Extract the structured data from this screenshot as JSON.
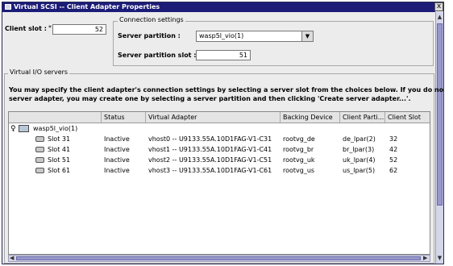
{
  "window": {
    "title": "Virtual SCSI -- Client Adapter Properties",
    "close_label": "x"
  },
  "client_slot": {
    "label": "Client slot :",
    "required_mark": "*",
    "value": "52"
  },
  "connection": {
    "legend": "Connection settings",
    "partition_label": "Server partition :",
    "partition_value": "wasp5l_vio(1)",
    "slot_label": "Server partition slot :",
    "slot_value": "51"
  },
  "vio": {
    "legend": "Virtual I/O servers",
    "instructions": [
      "You may specify the client adapter's connection settings by selecting a server slot from the choices below. If you do not see a",
      "server adapter, you may create one by selecting a server partition and then clicking 'Create server adapter...'."
    ]
  },
  "table": {
    "headers": [
      "Status",
      "Virtual Adapter",
      "Backing Device",
      "Client Parti...",
      "Client Slot",
      "C"
    ],
    "root": "wasp5l_vio(1)",
    "rows": [
      {
        "slot": "Slot 31",
        "status": "Inactive",
        "adapter": "vhost0 -- U9133.55A.10D1FAG-V1-C31",
        "backing": "rootvg_de",
        "client": "de_lpar(2)",
        "client_slot": "32"
      },
      {
        "slot": "Slot 41",
        "status": "Inactive",
        "adapter": "vhost1 -- U9133.55A.10D1FAG-V1-C41",
        "backing": "rootvg_br",
        "client": "br_lpar(3)",
        "client_slot": "42"
      },
      {
        "slot": "Slot 51",
        "status": "Inactive",
        "adapter": "vhost2 -- U9133.55A.10D1FAG-V1-C51",
        "backing": "rootvg_uk",
        "client": "uk_lpar(4)",
        "client_slot": "52"
      },
      {
        "slot": "Slot 61",
        "status": "Inactive",
        "adapter": "vhost3 -- U9133.55A.10D1FAG-V1-C61",
        "backing": "rootvg_us",
        "client": "us_lpar(5)",
        "client_slot": "62"
      }
    ]
  },
  "icons": {
    "window": "window-icon",
    "server": "server-icon",
    "slot": "slot-icon",
    "tree_toggle": "tree-toggle-icon",
    "dropdown": "chevron-down-icon"
  },
  "colors": {
    "titlebar": "#1c1c78",
    "scrollbar": "#9898cc",
    "panel": "#ececec"
  }
}
